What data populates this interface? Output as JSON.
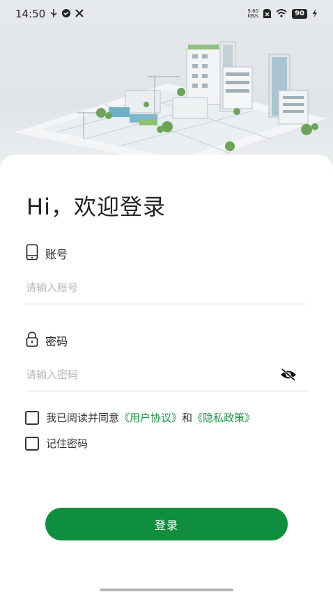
{
  "status_bar": {
    "time": "14:50",
    "left_icons": [
      "usb-icon",
      "check-circle-icon",
      "tools-icon"
    ],
    "net_speed_value": "9.60",
    "net_speed_unit": "KB/s",
    "battery": "90"
  },
  "login": {
    "greeting": "Hi，欢迎登录",
    "account_label": "账号",
    "account_placeholder": "请输入账号",
    "password_label": "密码",
    "password_placeholder": "请输入密码",
    "agree_prefix": "我已阅读并同意",
    "user_agreement": "《用户协议》",
    "agree_and": "和",
    "privacy_policy": "《隐私政策》",
    "remember_label": "记住密码",
    "login_button": "登录"
  },
  "colors": {
    "primary": "#0f8f3e",
    "link": "#1a9641",
    "placeholder": "#b8b8b8"
  }
}
